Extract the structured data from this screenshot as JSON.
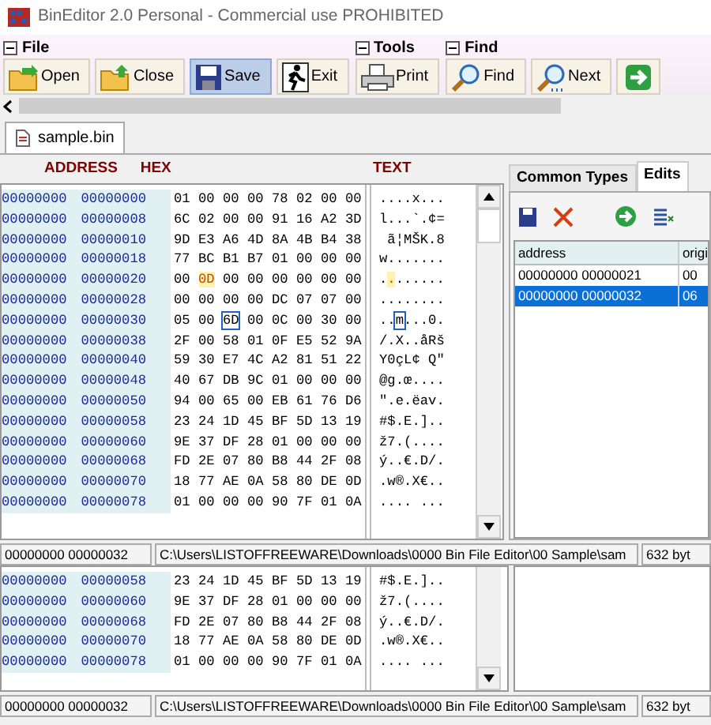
{
  "window": {
    "title": "BinEditor 2.0 Personal - Commercial use PROHIBITED"
  },
  "ribbon": {
    "groups": [
      {
        "label": "File",
        "buttons": [
          {
            "label": "Open",
            "selected": false
          },
          {
            "label": "Close",
            "selected": false
          },
          {
            "label": "Save",
            "selected": true
          },
          {
            "label": "Exit",
            "selected": false
          }
        ]
      },
      {
        "label": "Tools",
        "buttons": [
          {
            "label": "Print",
            "selected": false
          }
        ]
      },
      {
        "label": "Find",
        "buttons": [
          {
            "label": "Find",
            "selected": false
          },
          {
            "label": "Next",
            "selected": false
          },
          {
            "selected": false
          }
        ]
      }
    ]
  },
  "documents": [
    {
      "label": "sample.bin",
      "selected": true
    }
  ],
  "hex_view": {
    "headers": [
      "ADDRESS",
      "HEX",
      "TEXT"
    ],
    "rows": [
      {
        "address": [
          "00000000",
          "00000000"
        ],
        "hex": [
          "01",
          "00",
          "00",
          "00",
          "78",
          "02",
          "00",
          "00"
        ],
        "text": "....x..."
      },
      {
        "address": [
          "00000000",
          "00000008"
        ],
        "hex": [
          "6C",
          "02",
          "00",
          "00",
          "91",
          "16",
          "A2",
          "3D"
        ],
        "text": "l...`.¢="
      },
      {
        "address": [
          "00000000",
          "00000010"
        ],
        "hex": [
          "9D",
          "E3",
          "A6",
          "4D",
          "8A",
          "4B",
          "B4",
          "38"
        ],
        "text": " ã¦MŠK.8"
      },
      {
        "address": [
          "00000000",
          "00000018"
        ],
        "hex": [
          "77",
          "BC",
          "B1",
          "B7",
          "01",
          "00",
          "00",
          "00"
        ],
        "text": "w......."
      },
      {
        "address": [
          "00000000",
          "00000020"
        ],
        "hex": [
          "00",
          {
            "value": "0D",
            "modified": true
          },
          "00",
          "00",
          "00",
          "00",
          "00",
          "00"
        ],
        "text": "........"
      },
      {
        "address": [
          "00000000",
          "00000028"
        ],
        "hex": [
          "00",
          "00",
          "00",
          "00",
          "DC",
          "07",
          "07",
          "00"
        ],
        "text": "........"
      },
      {
        "address": [
          "00000000",
          "00000030"
        ],
        "hex": [
          "05",
          "00",
          {
            "value": "6D",
            "cursor": true
          },
          "00",
          "0C",
          "00",
          "30",
          "00"
        ],
        "text": "..m...0."
      },
      {
        "address": [
          "00000000",
          "00000038"
        ],
        "hex": [
          "2F",
          "00",
          "58",
          "01",
          "0F",
          "E5",
          "52",
          "9A"
        ],
        "text": "/.X..åRš"
      },
      {
        "address": [
          "00000000",
          "00000040"
        ],
        "hex": [
          "59",
          "30",
          "E7",
          "4C",
          "A2",
          "81",
          "51",
          "22"
        ],
        "text": "Y0çL¢ Q\""
      },
      {
        "address": [
          "00000000",
          "00000048"
        ],
        "hex": [
          "40",
          "67",
          "DB",
          "9C",
          "01",
          "00",
          "00",
          "00"
        ],
        "text": "@g.œ...."
      },
      {
        "address": [
          "00000000",
          "00000050"
        ],
        "hex": [
          "94",
          "00",
          "65",
          "00",
          "EB",
          "61",
          "76",
          "D6"
        ],
        "text": "\".e.ëav."
      },
      {
        "address": [
          "00000000",
          "00000058"
        ],
        "hex": [
          "23",
          "24",
          "1D",
          "45",
          "BF",
          "5D",
          "13",
          "19"
        ],
        "text": "#$.E.].."
      },
      {
        "address": [
          "00000000",
          "00000060"
        ],
        "hex": [
          "9E",
          "37",
          "DF",
          "28",
          "01",
          "00",
          "00",
          "00"
        ],
        "text": "ž7.(...."
      },
      {
        "address": [
          "00000000",
          "00000068"
        ],
        "hex": [
          "FD",
          "2E",
          "07",
          "80",
          "B8",
          "44",
          "2F",
          "08"
        ],
        "text": "ý..€.D/."
      },
      {
        "address": [
          "00000000",
          "00000070"
        ],
        "hex": [
          "18",
          "77",
          "AE",
          "0A",
          "58",
          "80",
          "DE",
          "0D"
        ],
        "text": ".w®.X€.."
      },
      {
        "address": [
          "00000000",
          "00000078"
        ],
        "hex": [
          "01",
          "00",
          "00",
          "00",
          "90",
          "7F",
          "01",
          "0A"
        ],
        "text": ".... ..."
      }
    ]
  },
  "side_panel": {
    "tabs": [
      {
        "label": "Common Types",
        "selected": false
      },
      {
        "label": "Edits",
        "selected": true
      }
    ],
    "table": {
      "columns": [
        "address",
        "origi"
      ],
      "rows": [
        {
          "cells": [
            "00000000 00000021",
            "00"
          ],
          "selected": false
        },
        {
          "cells": [
            "00000000 00000032",
            "06"
          ],
          "selected": true
        }
      ]
    }
  },
  "status_bar": {
    "offset": "00000000 00000032",
    "path": "C:\\Users\\LISTOFFREEWARE\\Downloads\\0000 Bin File Editor\\00 Sample\\sam",
    "size": "632 byt"
  },
  "lower_view": {
    "rows": [
      {
        "address": [
          "00000000",
          "00000058"
        ],
        "hex": [
          "23",
          "24",
          "1D",
          "45",
          "BF",
          "5D",
          "13",
          "19"
        ],
        "text": "#$.E.].."
      },
      {
        "address": [
          "00000000",
          "00000060"
        ],
        "hex": [
          "9E",
          "37",
          "DF",
          "28",
          "01",
          "00",
          "00",
          "00"
        ],
        "text": "ž7.(...."
      },
      {
        "address": [
          "00000000",
          "00000068"
        ],
        "hex": [
          "FD",
          "2E",
          "07",
          "80",
          "B8",
          "44",
          "2F",
          "08"
        ],
        "text": "ý..€.D/."
      },
      {
        "address": [
          "00000000",
          "00000070"
        ],
        "hex": [
          "18",
          "77",
          "AE",
          "0A",
          "58",
          "80",
          "DE",
          "0D"
        ],
        "text": ".w®.X€.."
      },
      {
        "address": [
          "00000000",
          "00000078"
        ],
        "hex": [
          "01",
          "00",
          "00",
          "00",
          "90",
          "7F",
          "01",
          "0A"
        ],
        "text": ".... ..."
      }
    ]
  },
  "status_bar_2": {
    "offset": "00000000 00000032",
    "path": "C:\\Users\\LISTOFFREEWARE\\Downloads\\0000 Bin File Editor\\00 Sample\\sam",
    "size": "632 byt"
  }
}
